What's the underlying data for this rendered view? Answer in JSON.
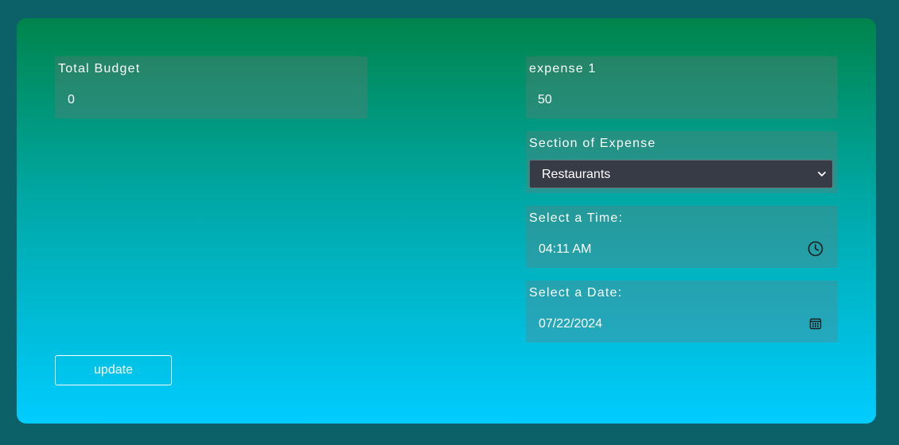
{
  "budget": {
    "label": "Total Budget",
    "value": "0"
  },
  "expense": {
    "label": "expense 1",
    "value": "50"
  },
  "section": {
    "label": "Section of Expense",
    "selected": "Restaurants"
  },
  "time": {
    "label": "Select a Time:",
    "value": "04:11 AM"
  },
  "date": {
    "label": "Select a Date:",
    "value": "07/22/2024"
  },
  "actions": {
    "update_label": "update"
  },
  "icons": {
    "time_icon": "clock-icon",
    "date_icon": "calendar-icon",
    "select_icon": "chevron-down-icon"
  }
}
